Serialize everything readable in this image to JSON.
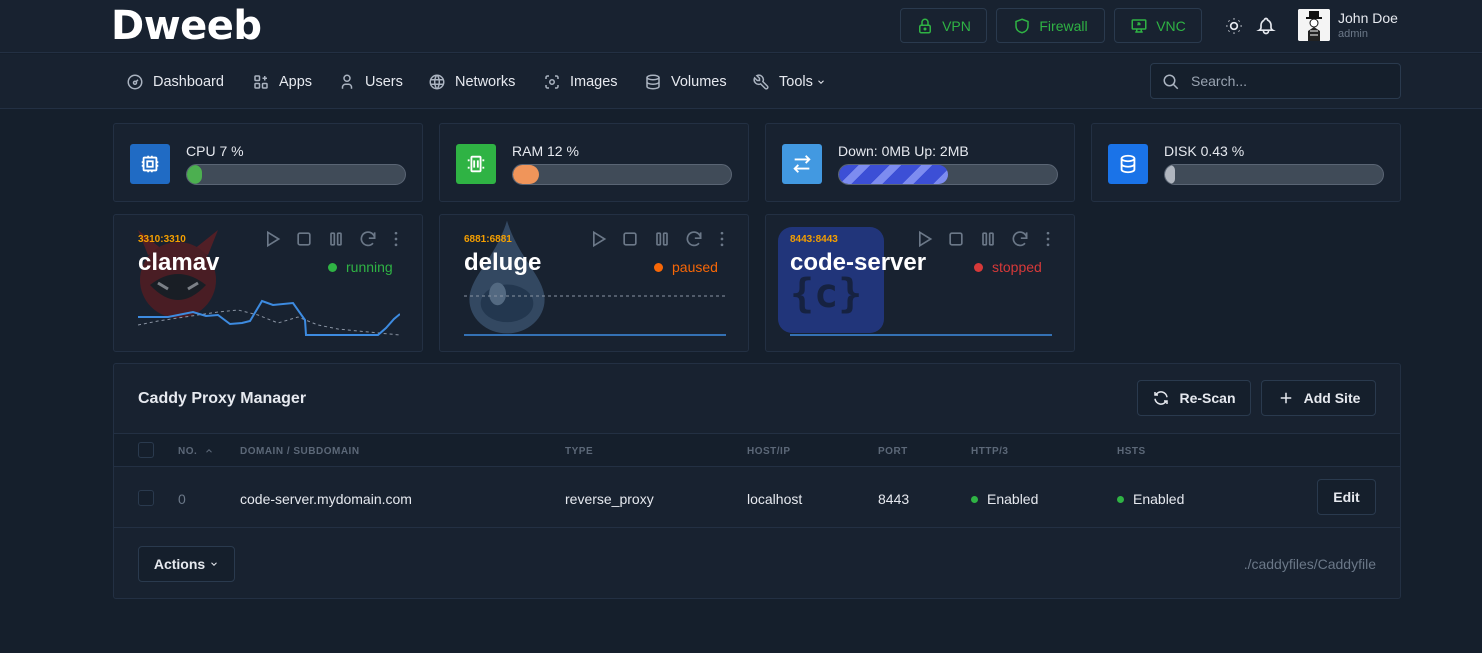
{
  "app": {
    "logo": "Dweeb"
  },
  "header": {
    "buttons": [
      {
        "label": "VPN",
        "icon": "lock-icon"
      },
      {
        "label": "Firewall",
        "icon": "shield-icon"
      },
      {
        "label": "VNC",
        "icon": "monitor-share-icon"
      }
    ],
    "accent_color": "#2fb344",
    "user": {
      "name": "John Doe",
      "role": "admin"
    }
  },
  "nav": {
    "items": [
      {
        "label": "Dashboard",
        "icon": "dashboard-icon"
      },
      {
        "label": "Apps",
        "icon": "apps-icon"
      },
      {
        "label": "Users",
        "icon": "user-icon"
      },
      {
        "label": "Networks",
        "icon": "globe-icon"
      },
      {
        "label": "Images",
        "icon": "photo-scan-icon"
      },
      {
        "label": "Volumes",
        "icon": "database-icon"
      },
      {
        "label": "Tools",
        "icon": "tool-icon"
      }
    ],
    "search_placeholder": "Search..."
  },
  "stats": [
    {
      "label": "CPU 7 %",
      "percent": 7,
      "color": "#206bc4",
      "fill": "#4caf50"
    },
    {
      "label": "RAM 12 %",
      "percent": 12,
      "color": "#2fb344",
      "fill": "#f0955a"
    },
    {
      "label": "Down: 0MB Up: 2MB",
      "percent": 50,
      "color": "#4299e1",
      "fill": "#3345c8"
    },
    {
      "label": "DISK 0.43 %",
      "percent": 0.43,
      "color": "#1a73e8",
      "fill": "#b0b6bf"
    }
  ],
  "apps": [
    {
      "port": "3310:3310",
      "name": "clamav",
      "status": "running",
      "status_color": "#2fb344"
    },
    {
      "port": "6881:6881",
      "name": "deluge",
      "status": "paused",
      "status_color": "#f76707"
    },
    {
      "port": "8443:8443",
      "name": "code-server",
      "status": "stopped",
      "status_color": "#d63939"
    }
  ],
  "proxy": {
    "title": "Caddy Proxy Manager",
    "rescan_label": "Re-Scan",
    "add_label": "Add Site",
    "columns": [
      "NO.",
      "DOMAIN / SUBDOMAIN",
      "TYPE",
      "HOST/IP",
      "PORT",
      "HTTP/3",
      "HSTS"
    ],
    "rows": [
      {
        "no": "0",
        "domain": "code-server.mydomain.com",
        "type": "reverse_proxy",
        "host": "localhost",
        "port": "8443",
        "http3": "Enabled",
        "hsts": "Enabled",
        "action": "Edit"
      }
    ],
    "actions_label": "Actions",
    "file_path": "./caddyfiles/Caddyfile"
  }
}
